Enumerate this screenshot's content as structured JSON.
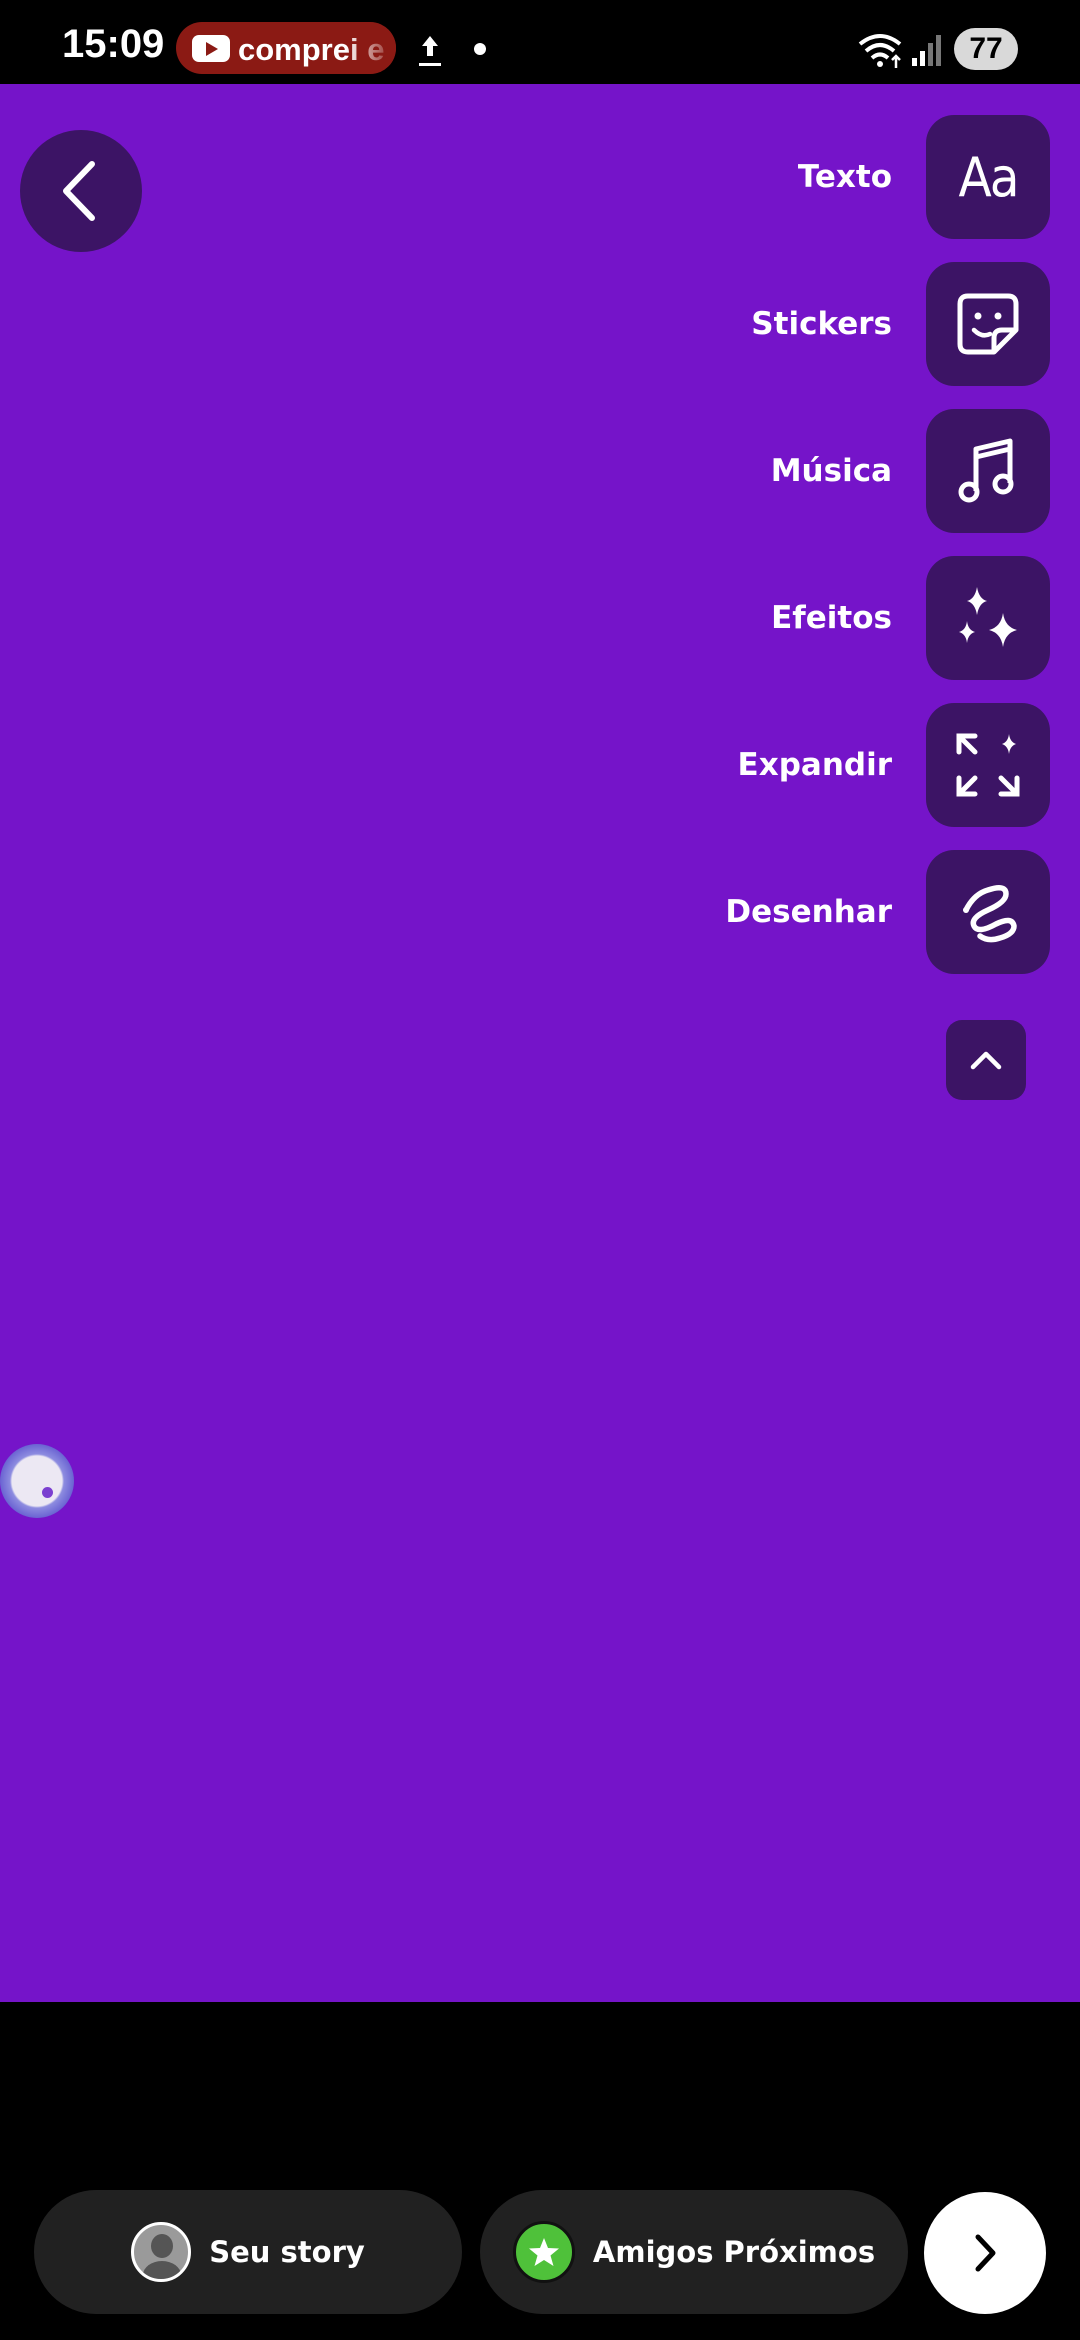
{
  "status_bar": {
    "time": "15:09",
    "notification_text": "comprei e",
    "battery": "77"
  },
  "editor": {
    "background_color": "#7514c9",
    "tools": [
      {
        "label": "Texto",
        "icon": "text-aa-icon"
      },
      {
        "label": "Stickers",
        "icon": "sticker-icon"
      },
      {
        "label": "Música",
        "icon": "music-note-icon"
      },
      {
        "label": "Efeitos",
        "icon": "sparkles-icon"
      },
      {
        "label": "Expandir",
        "icon": "expand-icon"
      },
      {
        "label": "Desenhar",
        "icon": "draw-squiggle-icon"
      }
    ],
    "text_tool_glyph": "Aa"
  },
  "share_bar": {
    "your_story_label": "Seu story",
    "close_friends_label": "Amigos Próximos",
    "close_friends_color": "#4fc13a"
  }
}
